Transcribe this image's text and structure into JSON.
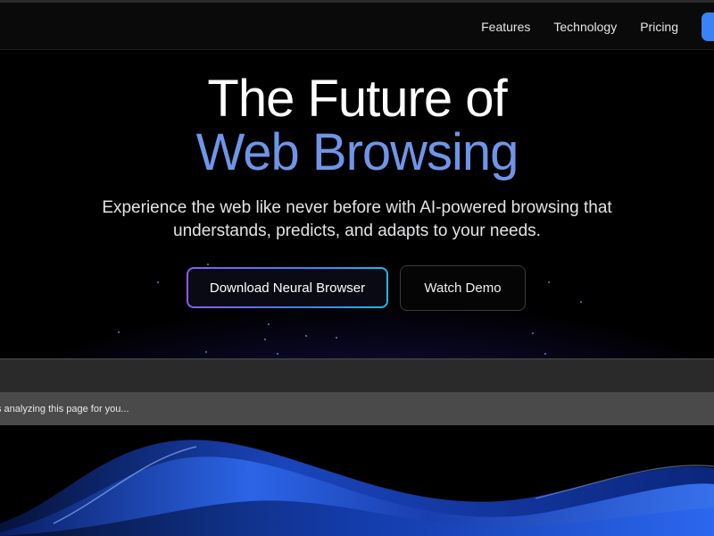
{
  "nav": {
    "links": [
      "Features",
      "Technology",
      "Pricing"
    ]
  },
  "hero": {
    "title_line1": "The Future of",
    "title_line2": "Web Browsing",
    "subtitle_line1": "Experience the web like never before with AI-powered browsing that",
    "subtitle_line2": "understands, predicts, and adapts to your needs.",
    "primary_button": "Download Neural Browser",
    "secondary_button": "Watch Demo"
  },
  "status": {
    "text": "s analyzing this page for you..."
  },
  "colors": {
    "accent_blue": "#3b82f6",
    "title_accent": "#6f95e8",
    "gradient_purple": "#8b5cf6",
    "gradient_cyan": "#22b8e6"
  }
}
